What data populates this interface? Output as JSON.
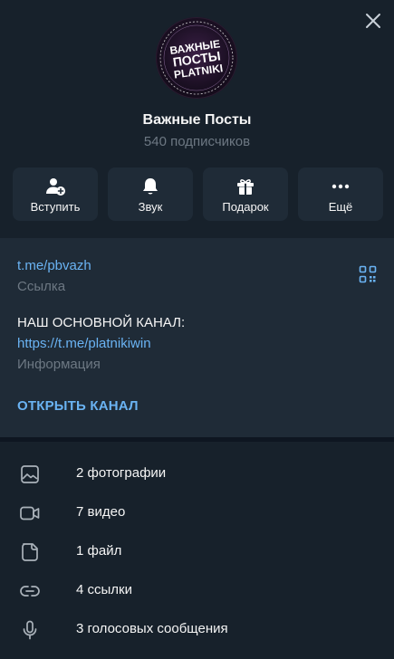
{
  "header": {
    "avatar_text": [
      "ВАЖНЫЕ",
      "ПОСТЫ",
      "PLATNIKI"
    ],
    "title": "Важные Посты",
    "subtitle": "540 подписчиков"
  },
  "actions": [
    {
      "label": "Вступить",
      "icon": "add-user-icon"
    },
    {
      "label": "Звук",
      "icon": "bell-icon"
    },
    {
      "label": "Подарок",
      "icon": "gift-icon"
    },
    {
      "label": "Ещё",
      "icon": "more-dots-icon"
    }
  ],
  "info": {
    "link_value": "t.me/pbvazh",
    "link_caption": "Ссылка",
    "description_line1": "НАШ ОСНОВНОЙ КАНАЛ:",
    "description_link": "https://t.me/platnikiwin",
    "description_caption": "Информация",
    "open_channel": "ОТКРЫТЬ КАНАЛ"
  },
  "media": [
    {
      "label": "2 фотографии",
      "icon": "photo-icon"
    },
    {
      "label": "7 видео",
      "icon": "video-icon"
    },
    {
      "label": "1 файл",
      "icon": "file-icon"
    },
    {
      "label": "4 ссылки",
      "icon": "link-icon"
    },
    {
      "label": "3 голосовых сообщения",
      "icon": "microphone-icon"
    }
  ],
  "colors": {
    "background": "#17212b",
    "panel": "#1f2b37",
    "accent": "#6ab3f3",
    "muted": "#6d7883"
  }
}
